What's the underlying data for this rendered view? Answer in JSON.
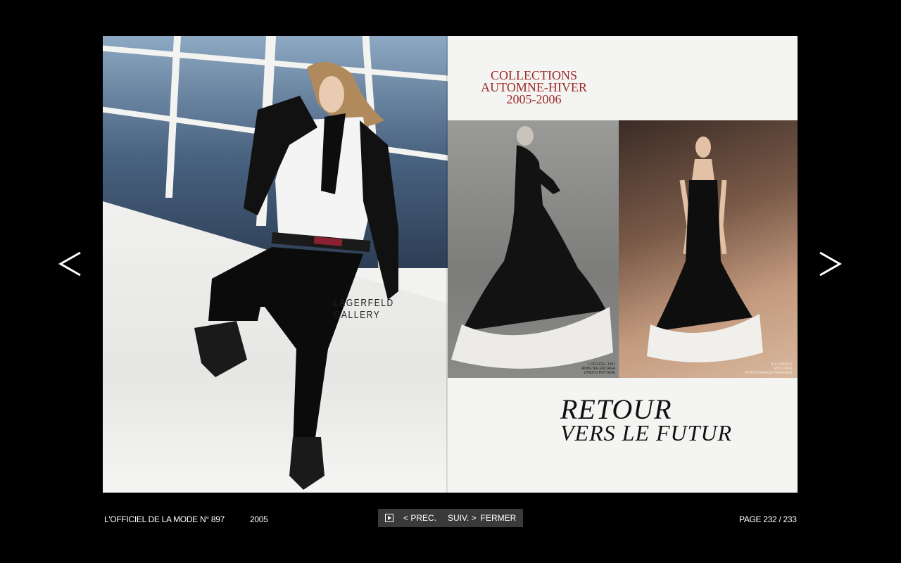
{
  "viewer": {
    "prev_arrow_icon": "chevron-left-icon",
    "next_arrow_icon": "chevron-right-icon"
  },
  "left_page": {
    "ad_brand": "LAGERFELD GALLERY"
  },
  "right_page": {
    "header": [
      "COLLECTIONS",
      "AUTOMNE-HIVER",
      "2005-2006"
    ],
    "caption_bw": [
      "L'OFFICIEL 1951",
      "ROBE BALENCIAGA",
      "(PHOTO POTTIER)"
    ],
    "caption_color": [
      "ALEXANDER",
      "MCQUEEN",
      "(PHOTO MARCIO MADEIRA)"
    ],
    "title_line1": "RETOUR",
    "title_line2": "VERS LE FUTUR"
  },
  "footer": {
    "magazine": "L'OFFICIEL DE LA MODE N° 897",
    "year": "2005",
    "page": "PAGE 232 / 233",
    "controls": {
      "play_icon": "play-icon",
      "prev_label": "< PREC.",
      "next_label": "SUIV. >",
      "close_label": "FERMER"
    }
  },
  "colors": {
    "background": "#000000",
    "header_red": "#a02a2a",
    "controls_bg": "#3a3a3a"
  }
}
